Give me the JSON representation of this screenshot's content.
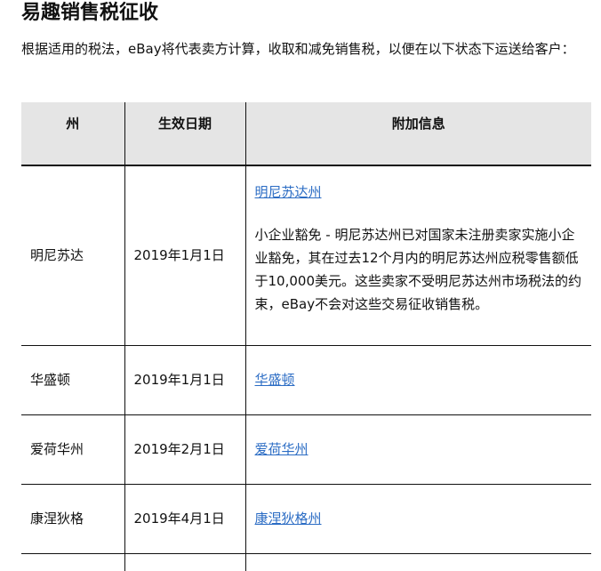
{
  "page": {
    "title": "易趣销售税征收",
    "intro": "根据适用的税法，eBay将代表卖方计算，收取和减免销售税，以便在以下状态下运送给客户："
  },
  "table": {
    "headers": [
      "州",
      "生效日期",
      "附加信息"
    ],
    "rows": [
      {
        "state": "明尼苏达",
        "date": "2019年1月1日",
        "link": "明尼苏达州",
        "note": "小企业豁免 - 明尼苏达州已对国家未注册卖家实施小企业豁免，其在过去12个月内的明尼苏达州应税零售额低于10,000美元。这些卖家不受明尼苏达州市场税法的约束，eBay不会对这些交易征收销售税。"
      },
      {
        "state": "华盛顿",
        "date": "2019年1月1日",
        "link": "华盛顿"
      },
      {
        "state": "爱荷华州",
        "date": "2019年2月1日",
        "link": "爱荷华州"
      },
      {
        "state": "康涅狄格",
        "date": "2019年4月1日",
        "link": "康涅狄格州"
      }
    ]
  },
  "colors": {
    "link": "#2b6cc4",
    "header_bg": "#e5e5e5"
  }
}
